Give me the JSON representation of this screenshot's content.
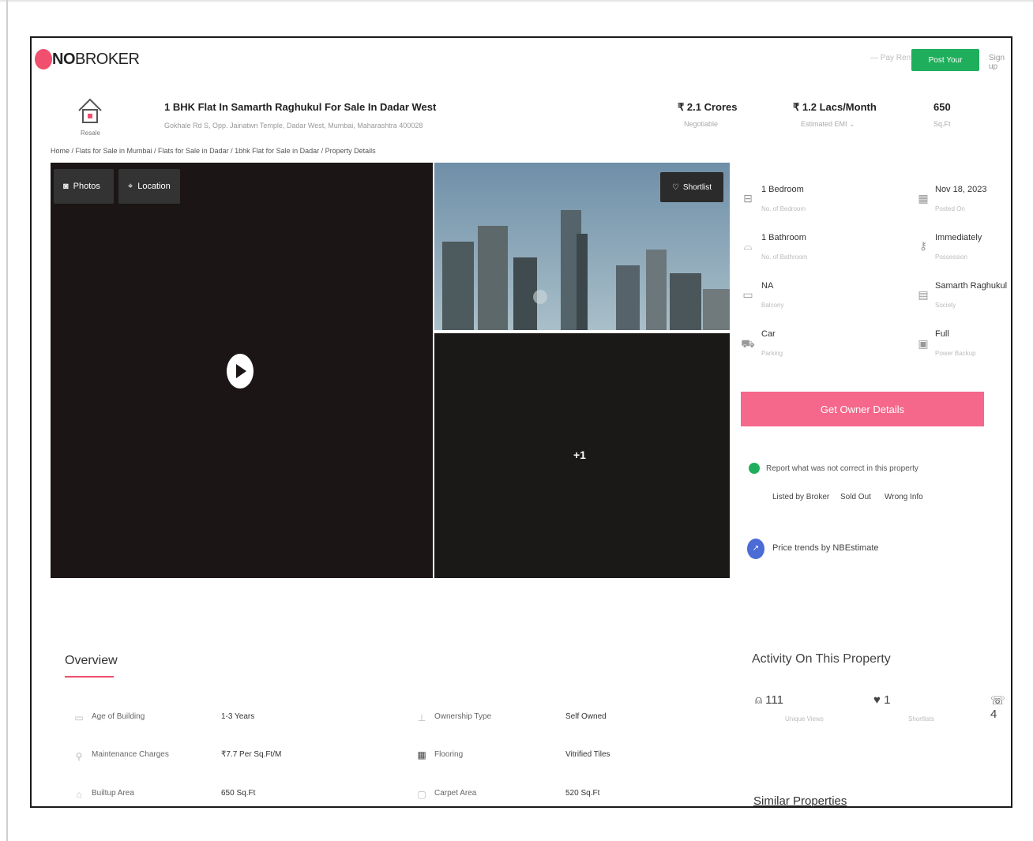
{
  "header": {
    "logo_bold": "NO",
    "logo_rest": "BROKER",
    "pay_rent": "Pay Rent",
    "post_property": "Post Your Property",
    "sign_up": "Sign up"
  },
  "listing": {
    "resale_label": "Resale",
    "title": "1 BHK Flat In Samarth Raghukul For Sale In Dadar West",
    "address": "Gokhale Rd S, Opp. Jainatwn Temple, Dadar West, Mumbai, Maharashtra 400028",
    "price": "₹ 2.1 Crores",
    "price_note": "Negotiable",
    "emi": "₹ 1.2 Lacs/Month",
    "emi_note": "Estimated EMI ⌄",
    "area": "650",
    "area_unit": "Sq.Ft"
  },
  "breadcrumb": "Home / Flats for Sale in Mumbai / Flats for Sale in Dadar / 1bhk Flat for Sale in Dadar / Property Details",
  "gallery": {
    "photos": "Photos",
    "location": "Location",
    "shortlist": "Shortlist",
    "more": "+1"
  },
  "details": [
    {
      "value": "1 Bedroom",
      "label": "No. of Bedroom",
      "icon": "bed-icon"
    },
    {
      "value": "Nov 18, 2023",
      "label": "Posted On",
      "icon": "calendar-icon"
    },
    {
      "value": "1 Bathroom",
      "label": "No. of Bathroom",
      "icon": "bath-icon"
    },
    {
      "value": "Immediately",
      "label": "Possession",
      "icon": "key-icon"
    },
    {
      "value": "NA",
      "label": "Balcony",
      "icon": "balcony-icon"
    },
    {
      "value": "Samarth Raghukul",
      "label": "Society",
      "icon": "building-icon"
    },
    {
      "value": "Car",
      "label": "Parking",
      "icon": "car-icon"
    },
    {
      "value": "Full",
      "label": "Power Backup",
      "icon": "power-icon"
    }
  ],
  "actions": {
    "owner_details": "Get Owner Details",
    "report_text": "Report what was not correct in this property",
    "chips": [
      "Listed by Broker",
      "Sold Out",
      "Wrong Info"
    ],
    "price_trends": "Price trends by NBEstimate"
  },
  "overview": {
    "title": "Overview",
    "rows": [
      {
        "label": "Age of Building",
        "value": "1-3 Years",
        "icon": "building-age-icon"
      },
      {
        "label": "Ownership Type",
        "value": "Self Owned",
        "icon": "ownership-icon"
      },
      {
        "label": "Maintenance Charges",
        "value": "₹7.7 Per Sq.Ft/M",
        "icon": "maintenance-icon"
      },
      {
        "label": "Flooring",
        "value": "Vitrified Tiles",
        "icon": "flooring-icon"
      },
      {
        "label": "Builtup Area",
        "value": "650 Sq.Ft",
        "icon": "builtup-icon"
      },
      {
        "label": "Carpet Area",
        "value": "520 Sq.Ft",
        "icon": "carpet-icon"
      }
    ]
  },
  "activity": {
    "title": "Activity On This Property",
    "unique_views": "111",
    "unique_views_label": "Unique Views",
    "shortlists": "1",
    "shortlists_label": "Shortlists",
    "contacted": "4"
  },
  "similar": "Similar Properties"
}
